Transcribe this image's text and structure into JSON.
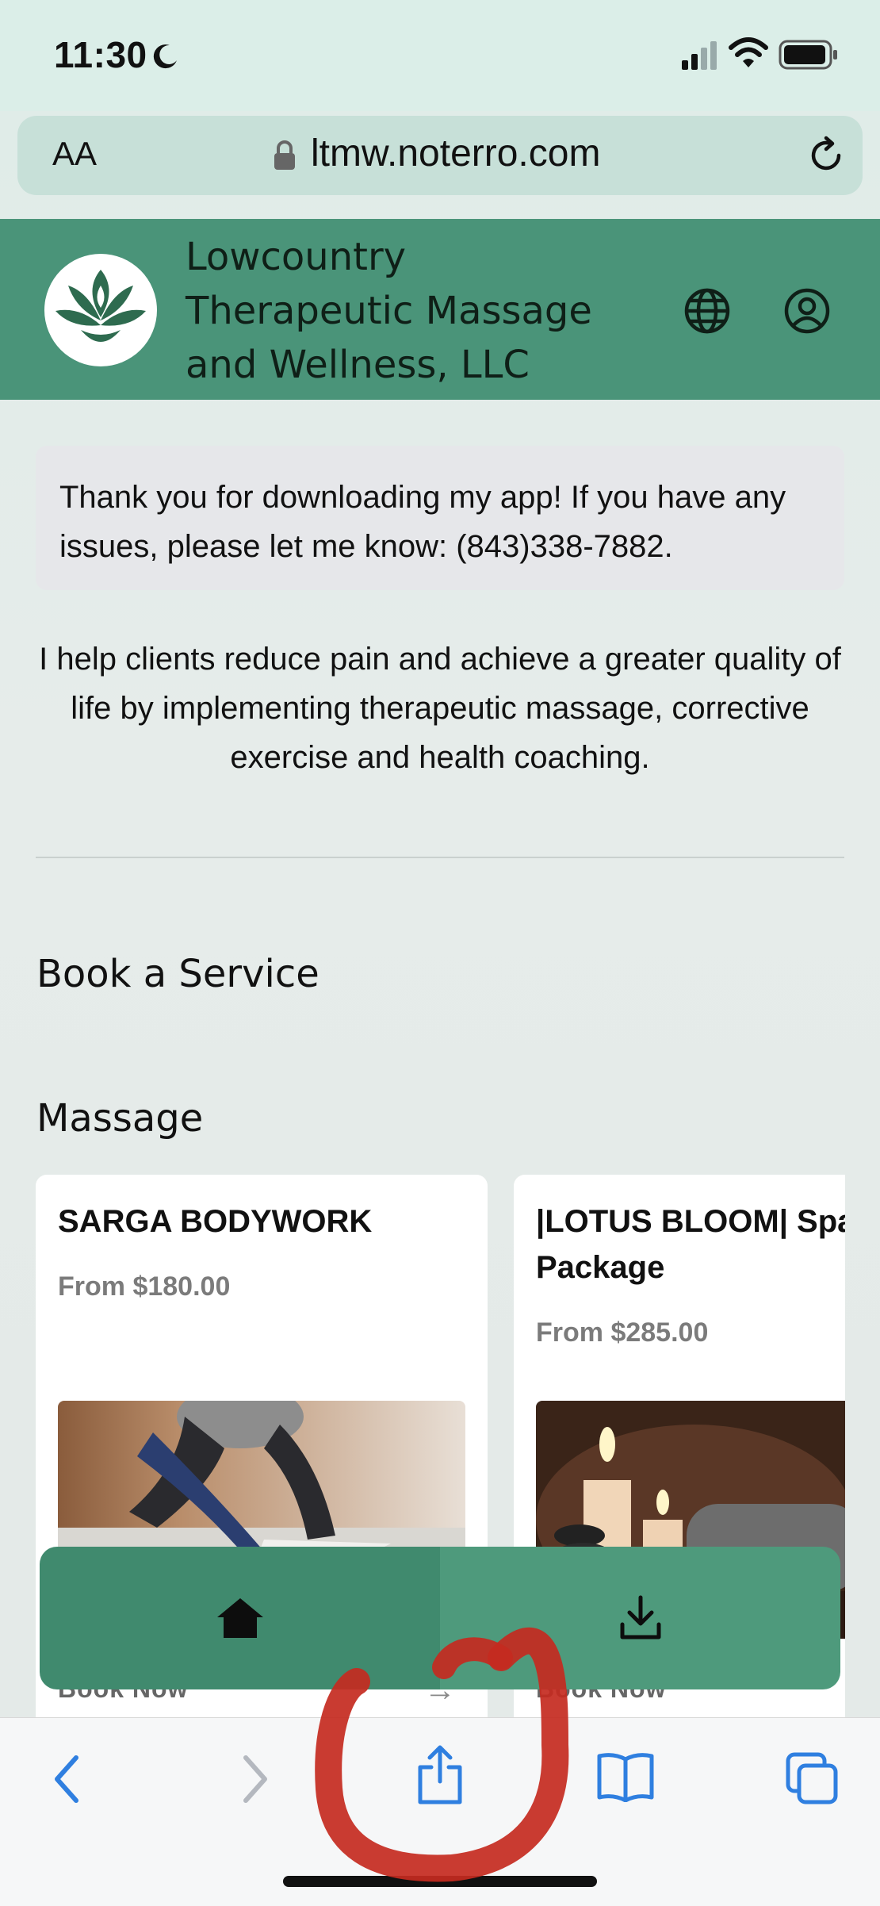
{
  "status_bar": {
    "time": "11:30"
  },
  "browser": {
    "text_size_label": "AA",
    "url": "ltmw.noterro.com"
  },
  "header": {
    "business_name": "Lowcountry Therapeutic Massage and Wellness, LLC"
  },
  "notice": {
    "text": "Thank you for downloading my app! If you have any issues, please let me know: (843)338-7882."
  },
  "intro": {
    "text": "I help clients reduce pain and achieve a greater quality of life by implementing therapeutic massage, corrective exercise and health coaching."
  },
  "booking": {
    "section_title": "Book a Service",
    "category": "Massage",
    "services": [
      {
        "title": "SARGA BODYWORK",
        "price": "From $180.00",
        "link": "Book Now"
      },
      {
        "title_line1": "|LOTUS BLOOM| Spa",
        "title_line2": "Package",
        "price": "From $285.00",
        "link": "Book Now"
      }
    ]
  },
  "app_nav": {
    "items": [
      {
        "icon": "home-icon"
      },
      {
        "icon": "download-icon"
      }
    ]
  },
  "safari_toolbar": {
    "items": [
      "back-icon",
      "forward-icon",
      "share-icon",
      "bookmarks-icon",
      "tabs-icon"
    ]
  },
  "colors": {
    "header_green": "#4a9479",
    "nav_dark_green": "#408a6e",
    "nav_light_green": "#4e9a7c",
    "safari_blue": "#2f7fe0",
    "annotation_red": "#c42a1f"
  }
}
